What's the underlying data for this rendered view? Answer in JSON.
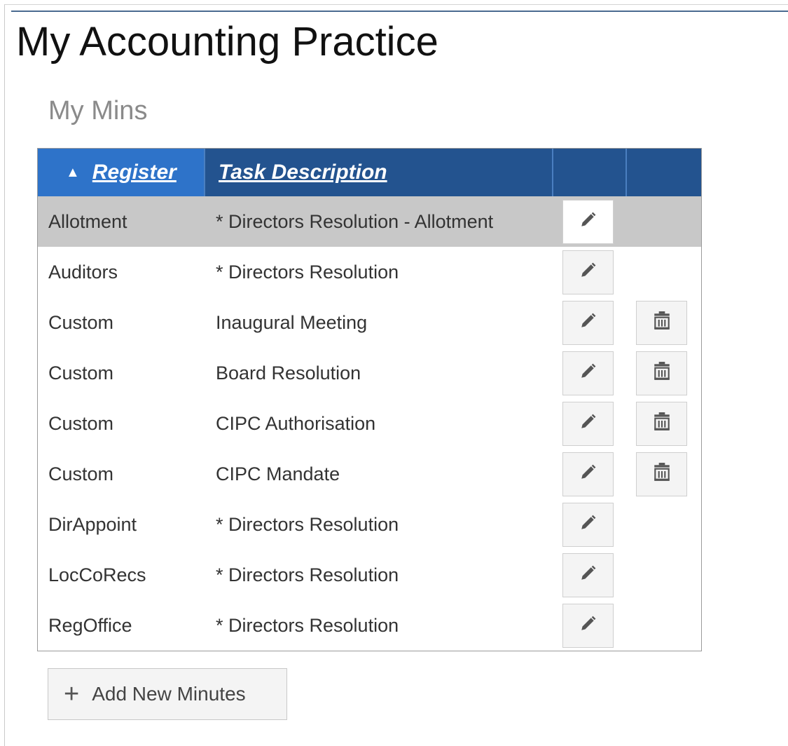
{
  "page": {
    "title": "My Accounting Practice"
  },
  "section": {
    "title": "My Mins"
  },
  "grid": {
    "columns": {
      "register": "Register",
      "task_description": "Task Description",
      "edit": "",
      "delete": ""
    },
    "sort": {
      "column": "register",
      "direction": "ascending",
      "indicator": "▲"
    },
    "rows": [
      {
        "register": "Allotment",
        "description": "* Directors Resolution - Allotment",
        "can_delete": false,
        "selected": true
      },
      {
        "register": "Auditors",
        "description": "* Directors Resolution",
        "can_delete": false,
        "selected": false
      },
      {
        "register": "Custom",
        "description": "Inaugural Meeting",
        "can_delete": true,
        "selected": false
      },
      {
        "register": "Custom",
        "description": "Board Resolution",
        "can_delete": true,
        "selected": false
      },
      {
        "register": "Custom",
        "description": "CIPC Authorisation",
        "can_delete": true,
        "selected": false
      },
      {
        "register": "Custom",
        "description": "CIPC Mandate",
        "can_delete": true,
        "selected": false
      },
      {
        "register": "DirAppoint",
        "description": "* Directors Resolution",
        "can_delete": false,
        "selected": false
      },
      {
        "register": "LocCoRecs",
        "description": "* Directors Resolution",
        "can_delete": false,
        "selected": false
      },
      {
        "register": "RegOffice",
        "description": "* Directors Resolution",
        "can_delete": false,
        "selected": false
      }
    ]
  },
  "actions": {
    "add_label": "Add New Minutes",
    "add_icon": "plus-icon"
  },
  "icons": {
    "edit": "pencil-icon",
    "delete": "trash-icon"
  },
  "colors": {
    "header_bg": "#23538f",
    "header_sorted_bg": "#2e73c9",
    "selected_row_bg": "#c8c8c8",
    "section_title": "#8a8a8a"
  }
}
